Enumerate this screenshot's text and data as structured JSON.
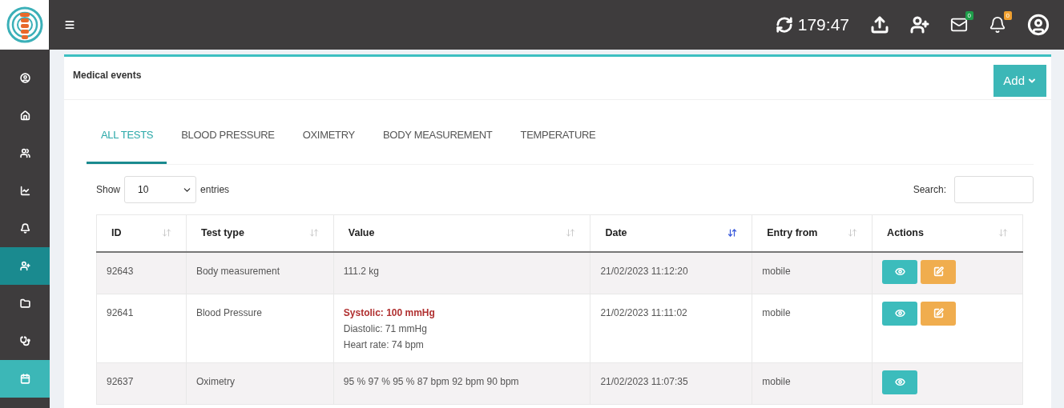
{
  "topbar": {
    "timer": "179:47",
    "mail_badge": {
      "count": "0",
      "color": "#1e9e4a"
    },
    "bell_badge": {
      "count": "0",
      "color": "#f0a030"
    }
  },
  "sidebar": {
    "items": [
      {
        "selected": false,
        "highlighted": false
      },
      {
        "selected": false,
        "highlighted": false
      },
      {
        "selected": false,
        "highlighted": false
      },
      {
        "selected": false,
        "highlighted": false
      },
      {
        "selected": false,
        "highlighted": false
      },
      {
        "selected": true,
        "highlighted": false
      },
      {
        "selected": false,
        "highlighted": false
      },
      {
        "selected": false,
        "highlighted": false
      },
      {
        "selected": false,
        "highlighted": true
      }
    ]
  },
  "panel": {
    "title": "Medical events",
    "add_button": "Add"
  },
  "tabs": [
    {
      "label": "ALL TESTS",
      "selected": true
    },
    {
      "label": "BLOOD PRESSURE",
      "selected": false
    },
    {
      "label": "OXIMETRY",
      "selected": false
    },
    {
      "label": "BODY MEASUREMENT",
      "selected": false
    },
    {
      "label": "TEMPERATURE",
      "selected": false
    }
  ],
  "table_controls": {
    "show_label": "Show",
    "page_size": "10",
    "entries_label": "entries",
    "search_label": "Search:"
  },
  "table": {
    "columns": [
      {
        "label": "ID",
        "sorted": false
      },
      {
        "label": "Test type",
        "sorted": false
      },
      {
        "label": "Value",
        "sorted": false
      },
      {
        "label": "Date",
        "sorted": true
      },
      {
        "label": "Entry from",
        "sorted": false
      },
      {
        "label": "Actions",
        "sorted": false
      }
    ],
    "rows": [
      {
        "id": "92643",
        "test_type": "Body measurement",
        "value": [
          {
            "text": "111.2 kg",
            "alert": false
          }
        ],
        "date": "21/02/2023 11:12:20",
        "entry_from": "mobile",
        "actions": [
          {
            "kind": "view"
          },
          {
            "kind": "edit"
          }
        ]
      },
      {
        "id": "92641",
        "test_type": "Blood Pressure",
        "value": [
          {
            "text": "Systolic: 100 mmHg",
            "alert": true
          },
          {
            "text": "Diastolic: 71 mmHg",
            "alert": false
          },
          {
            "text": "Heart rate: 74 bpm",
            "alert": false
          }
        ],
        "date": "21/02/2023 11:11:02",
        "entry_from": "mobile",
        "actions": [
          {
            "kind": "view"
          },
          {
            "kind": "edit"
          }
        ]
      },
      {
        "id": "92637",
        "test_type": "Oximetry",
        "value": [
          {
            "text": "95 % 97 % 95 % 87 bpm 92 bpm 90 bpm",
            "alert": false
          }
        ],
        "date": "21/02/2023 11:07:35",
        "entry_from": "mobile",
        "actions": [
          {
            "kind": "view"
          }
        ]
      }
    ]
  }
}
